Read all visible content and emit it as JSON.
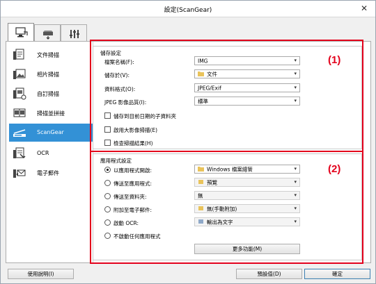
{
  "window": {
    "title": "設定(ScanGear)",
    "close_glyph": "✕"
  },
  "tabs": [
    {
      "icon": "scan-from-computer-icon",
      "active": true
    },
    {
      "icon": "scan-from-operation-panel-icon",
      "active": false
    },
    {
      "icon": "general-settings-icon",
      "active": false
    }
  ],
  "nav": {
    "items": [
      {
        "label": "文件掃描",
        "icon": "document-scan-icon"
      },
      {
        "label": "相片掃描",
        "icon": "photo-scan-icon"
      },
      {
        "label": "自訂掃描",
        "icon": "custom-scan-icon"
      },
      {
        "label": "掃描並拼接",
        "icon": "scan-and-stitch-icon"
      },
      {
        "label": "ScanGear",
        "icon": "scanner-driver-icon",
        "active": true
      },
      {
        "label": "OCR",
        "icon": "ocr-icon"
      },
      {
        "label": "電子郵件",
        "icon": "email-icon"
      }
    ]
  },
  "save_settings": {
    "title": "儲存設定",
    "callout": "(1)",
    "file_name": {
      "label": "檔案名稱(F):",
      "value": "IMG"
    },
    "save_in": {
      "label": "儲存於(V):",
      "value": "文件"
    },
    "data_format": {
      "label": "資料格式(O):",
      "value": "JPEG/Exif"
    },
    "jpeg_quality": {
      "label": "JPEG 影像品質(I):",
      "value": "標準"
    },
    "checkboxes": [
      {
        "label": "儲存到目前日期的子資料夾"
      },
      {
        "label": "啟用大影像掃描(E)"
      },
      {
        "label": "檢查掃描結果(H)"
      }
    ]
  },
  "app_settings": {
    "title": "應用程式設定",
    "callout": "(2)",
    "options": [
      {
        "label": "以應用程式開啟:",
        "value": "Windows 檔案總管",
        "selected": true
      },
      {
        "label": "傳送至應用程式:",
        "value": "預覽",
        "selected": false
      },
      {
        "label": "傳送至資料夾:",
        "value": "無",
        "selected": false
      },
      {
        "label": "附加至電子郵件:",
        "value": "無(手動附加)",
        "selected": false
      },
      {
        "label": "啟動 OCR:",
        "value": "輸出為文字",
        "selected": false
      },
      {
        "label": "不啟動任何應用程式",
        "selected": false
      }
    ],
    "more_functions": "更多功能(M)"
  },
  "footer": {
    "help": "使用說明(I)",
    "defaults": "預設值(D)",
    "ok": "確定"
  },
  "colors": {
    "accent": "#3391d6",
    "callout": "#e3001b"
  }
}
